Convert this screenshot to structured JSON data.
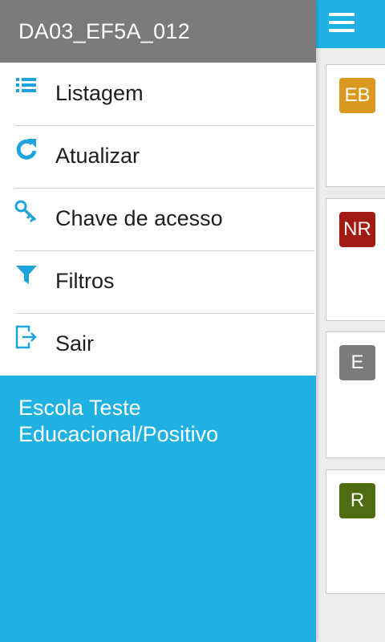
{
  "drawer": {
    "header_title": "DA03_EF5A_012",
    "items": [
      {
        "label": "Listagem",
        "icon": "list-icon"
      },
      {
        "label": "Atualizar",
        "icon": "refresh-icon"
      },
      {
        "label": "Chave de acesso",
        "icon": "key-icon"
      },
      {
        "label": "Filtros",
        "icon": "filter-icon"
      },
      {
        "label": "Sair",
        "icon": "exit-icon"
      }
    ],
    "school_line1": "Escola Teste",
    "school_line2": "Educacional/Positivo"
  },
  "background": {
    "menu_icon": "hamburger-menu-icon",
    "cards": [
      {
        "badge": "EB",
        "color": "#d9981f"
      },
      {
        "badge": "NR",
        "color": "#a21b12"
      },
      {
        "badge": "E",
        "color": "#7b7b7b"
      },
      {
        "badge": "R",
        "color": "#4e6d12"
      }
    ]
  },
  "colors": {
    "accent": "#1fb1e2",
    "header_gray": "#7b7b7b",
    "icon_blue": "#1fa3dc"
  }
}
